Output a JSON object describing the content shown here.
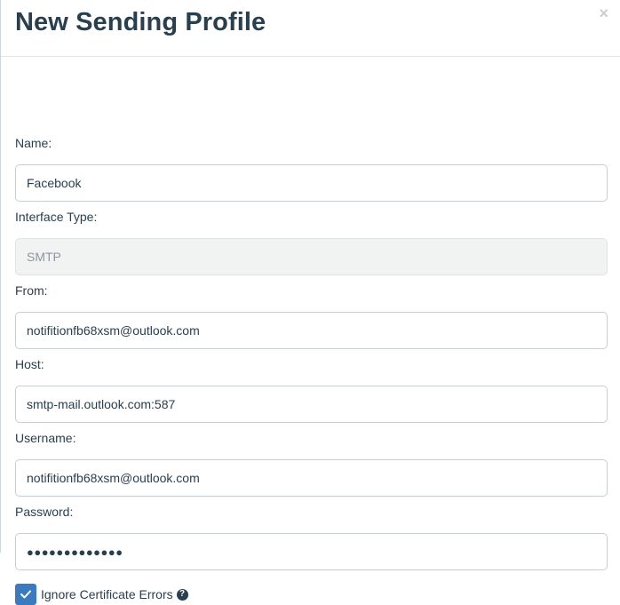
{
  "modal": {
    "title": "New Sending Profile",
    "close_glyph": "×"
  },
  "form": {
    "name": {
      "label": "Name:",
      "value": "Facebook"
    },
    "interface_type": {
      "label": "Interface Type:",
      "value": "SMTP"
    },
    "from": {
      "label": "From:",
      "value": "notifitionfb68xsm@outlook.com"
    },
    "host": {
      "label": "Host:",
      "value": "smtp-mail.outlook.com:587"
    },
    "username": {
      "label": "Username:",
      "value": "notifitionfb68xsm@outlook.com"
    },
    "password": {
      "label": "Password:",
      "value": "●●●●●●●●●●●●●"
    },
    "ignore_cert": {
      "label": "Ignore Certificate Errors",
      "checked": true,
      "help_glyph": "?"
    }
  },
  "colors": {
    "checkbox": "#3a7abf",
    "text": "#283f50"
  },
  "icons": {
    "close": "close-icon",
    "check": "checkmark-icon",
    "help": "question-circle-icon"
  }
}
